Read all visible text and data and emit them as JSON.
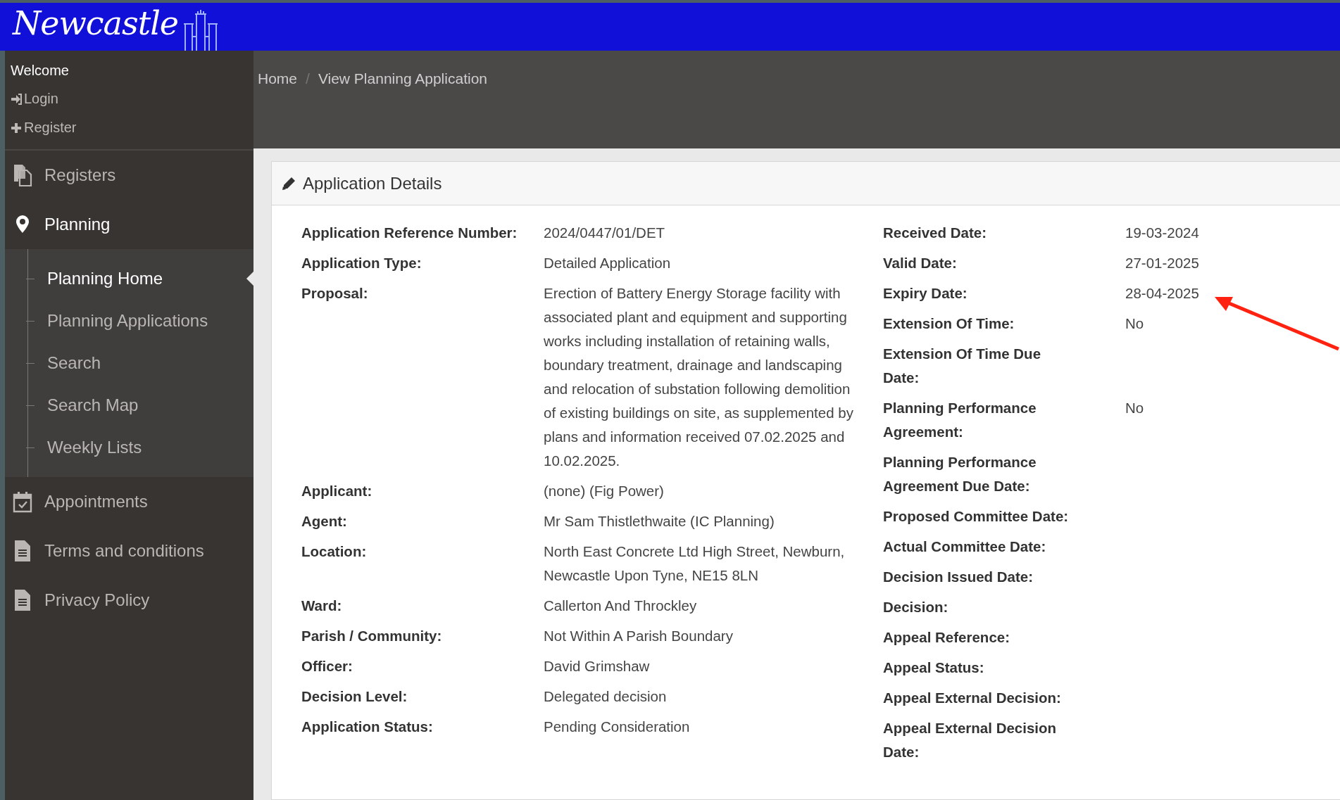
{
  "header": {
    "logo_text": "Newcastle"
  },
  "user_menu": {
    "welcome": "Welcome",
    "links": [
      {
        "label": "Login",
        "kind": "login"
      },
      {
        "label": "Register",
        "kind": "register"
      }
    ]
  },
  "nav": [
    {
      "label": "Registers",
      "kind": "files",
      "selected": false
    },
    {
      "label": "Planning",
      "kind": "pin",
      "selected": true,
      "children": [
        {
          "label": "Planning Home",
          "selected": true
        },
        {
          "label": "Planning Applications",
          "selected": false
        },
        {
          "label": "Search",
          "selected": false
        },
        {
          "label": "Search Map",
          "selected": false
        },
        {
          "label": "Weekly Lists",
          "selected": false
        }
      ]
    },
    {
      "label": "Appointments",
      "kind": "calendar",
      "selected": false
    },
    {
      "label": "Terms and conditions",
      "kind": "document",
      "selected": false
    },
    {
      "label": "Privacy Policy",
      "kind": "document",
      "selected": false
    }
  ],
  "breadcrumb": [
    "Home",
    "View Planning Application"
  ],
  "breadcrumb_separator": "/",
  "panel": {
    "title": "Application Details",
    "left_fields": [
      {
        "label": "Application Reference Number:",
        "value": "2024/0447/01/DET"
      },
      {
        "label": "Application Type:",
        "value": "Detailed Application"
      },
      {
        "label": "Proposal:",
        "value": "Erection of Battery Energy Storage facility with associated plant and equipment and supporting works including installation of retaining walls, boundary treatment, drainage and landscaping and relocation of substation following demolition of existing buildings on site, as supplemented by plans and information received 07.02.2025 and 10.02.2025."
      },
      {
        "label": "Applicant:",
        "value": "(none) (Fig Power)"
      },
      {
        "label": "Agent:",
        "value": "Mr Sam Thistlethwaite (IC Planning)"
      },
      {
        "label": "Location:",
        "value": "North East Concrete Ltd High Street, Newburn, Newcastle Upon Tyne, NE15 8LN"
      },
      {
        "label": "Ward:",
        "value": "Callerton And Throckley"
      },
      {
        "label": "Parish / Community:",
        "value": "Not Within A Parish Boundary"
      },
      {
        "label": "Officer:",
        "value": "David Grimshaw"
      },
      {
        "label": "Decision Level:",
        "value": "Delegated decision"
      },
      {
        "label": "Application Status:",
        "value": "Pending Consideration"
      }
    ],
    "right_fields": [
      {
        "label": "Received Date:",
        "value": "19-03-2024"
      },
      {
        "label": "Valid Date:",
        "value": "27-01-2025"
      },
      {
        "label": "Expiry Date:",
        "value": "28-04-2025"
      },
      {
        "label": "Extension Of Time:",
        "value": "No"
      },
      {
        "label": "Extension Of Time Due Date:"
      },
      {
        "label": "Planning Performance Agreement:",
        "value": "No"
      },
      {
        "label": "Planning Performance Agreement Due Date:"
      },
      {
        "label": "Proposed Committee Date:"
      },
      {
        "label": "Actual Committee Date:"
      },
      {
        "label": "Decision Issued Date:"
      },
      {
        "label": "Decision:"
      },
      {
        "label": "Appeal Reference:"
      },
      {
        "label": "Appeal Status:"
      },
      {
        "label": "Appeal External Decision:"
      },
      {
        "label": "Appeal External Decision Date:"
      }
    ]
  }
}
